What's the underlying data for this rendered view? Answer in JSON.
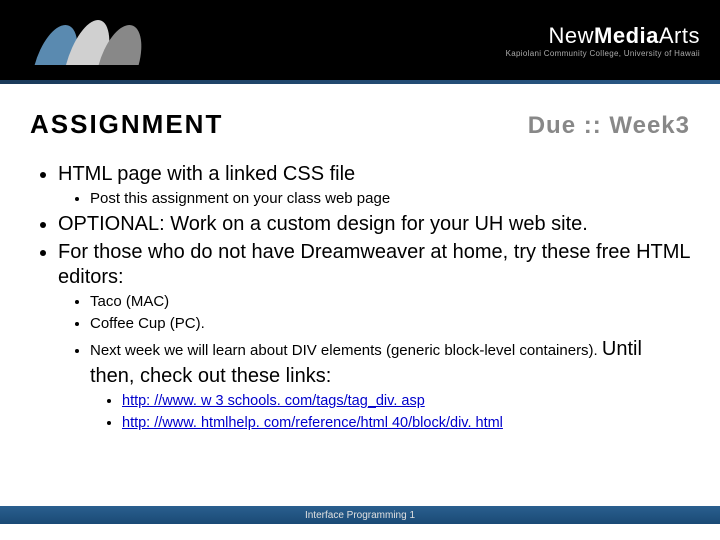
{
  "header": {
    "brand_prefix": "New",
    "brand_mid": "Media",
    "brand_suffix": "Arts",
    "brand_sub": "Kapiolani Community College, University of Hawaii"
  },
  "title": "ASSIGNMENT",
  "due": "Due :: Week3",
  "items": {
    "i0": "HTML page with a linked CSS file",
    "i0_0": "Post this assignment on your class web page",
    "i1": "OPTIONAL: Work on a custom design for your UH web site.",
    "i2": "For those who do not have Dreamweaver at home, try these free HTML editors:",
    "i2_0": "Taco (MAC)",
    "i2_1": "Coffee Cup (PC).",
    "i2_2a": "Next week we will learn about DIV elements (generic block-level containers). ",
    "i2_2b": "Until then, check out these links:",
    "link1": "http: //www. w 3 schools. com/tags/tag_div. asp",
    "link2": "http: //www. htmlhelp. com/reference/html 40/block/div. html"
  },
  "footer": "Interface Programming 1"
}
